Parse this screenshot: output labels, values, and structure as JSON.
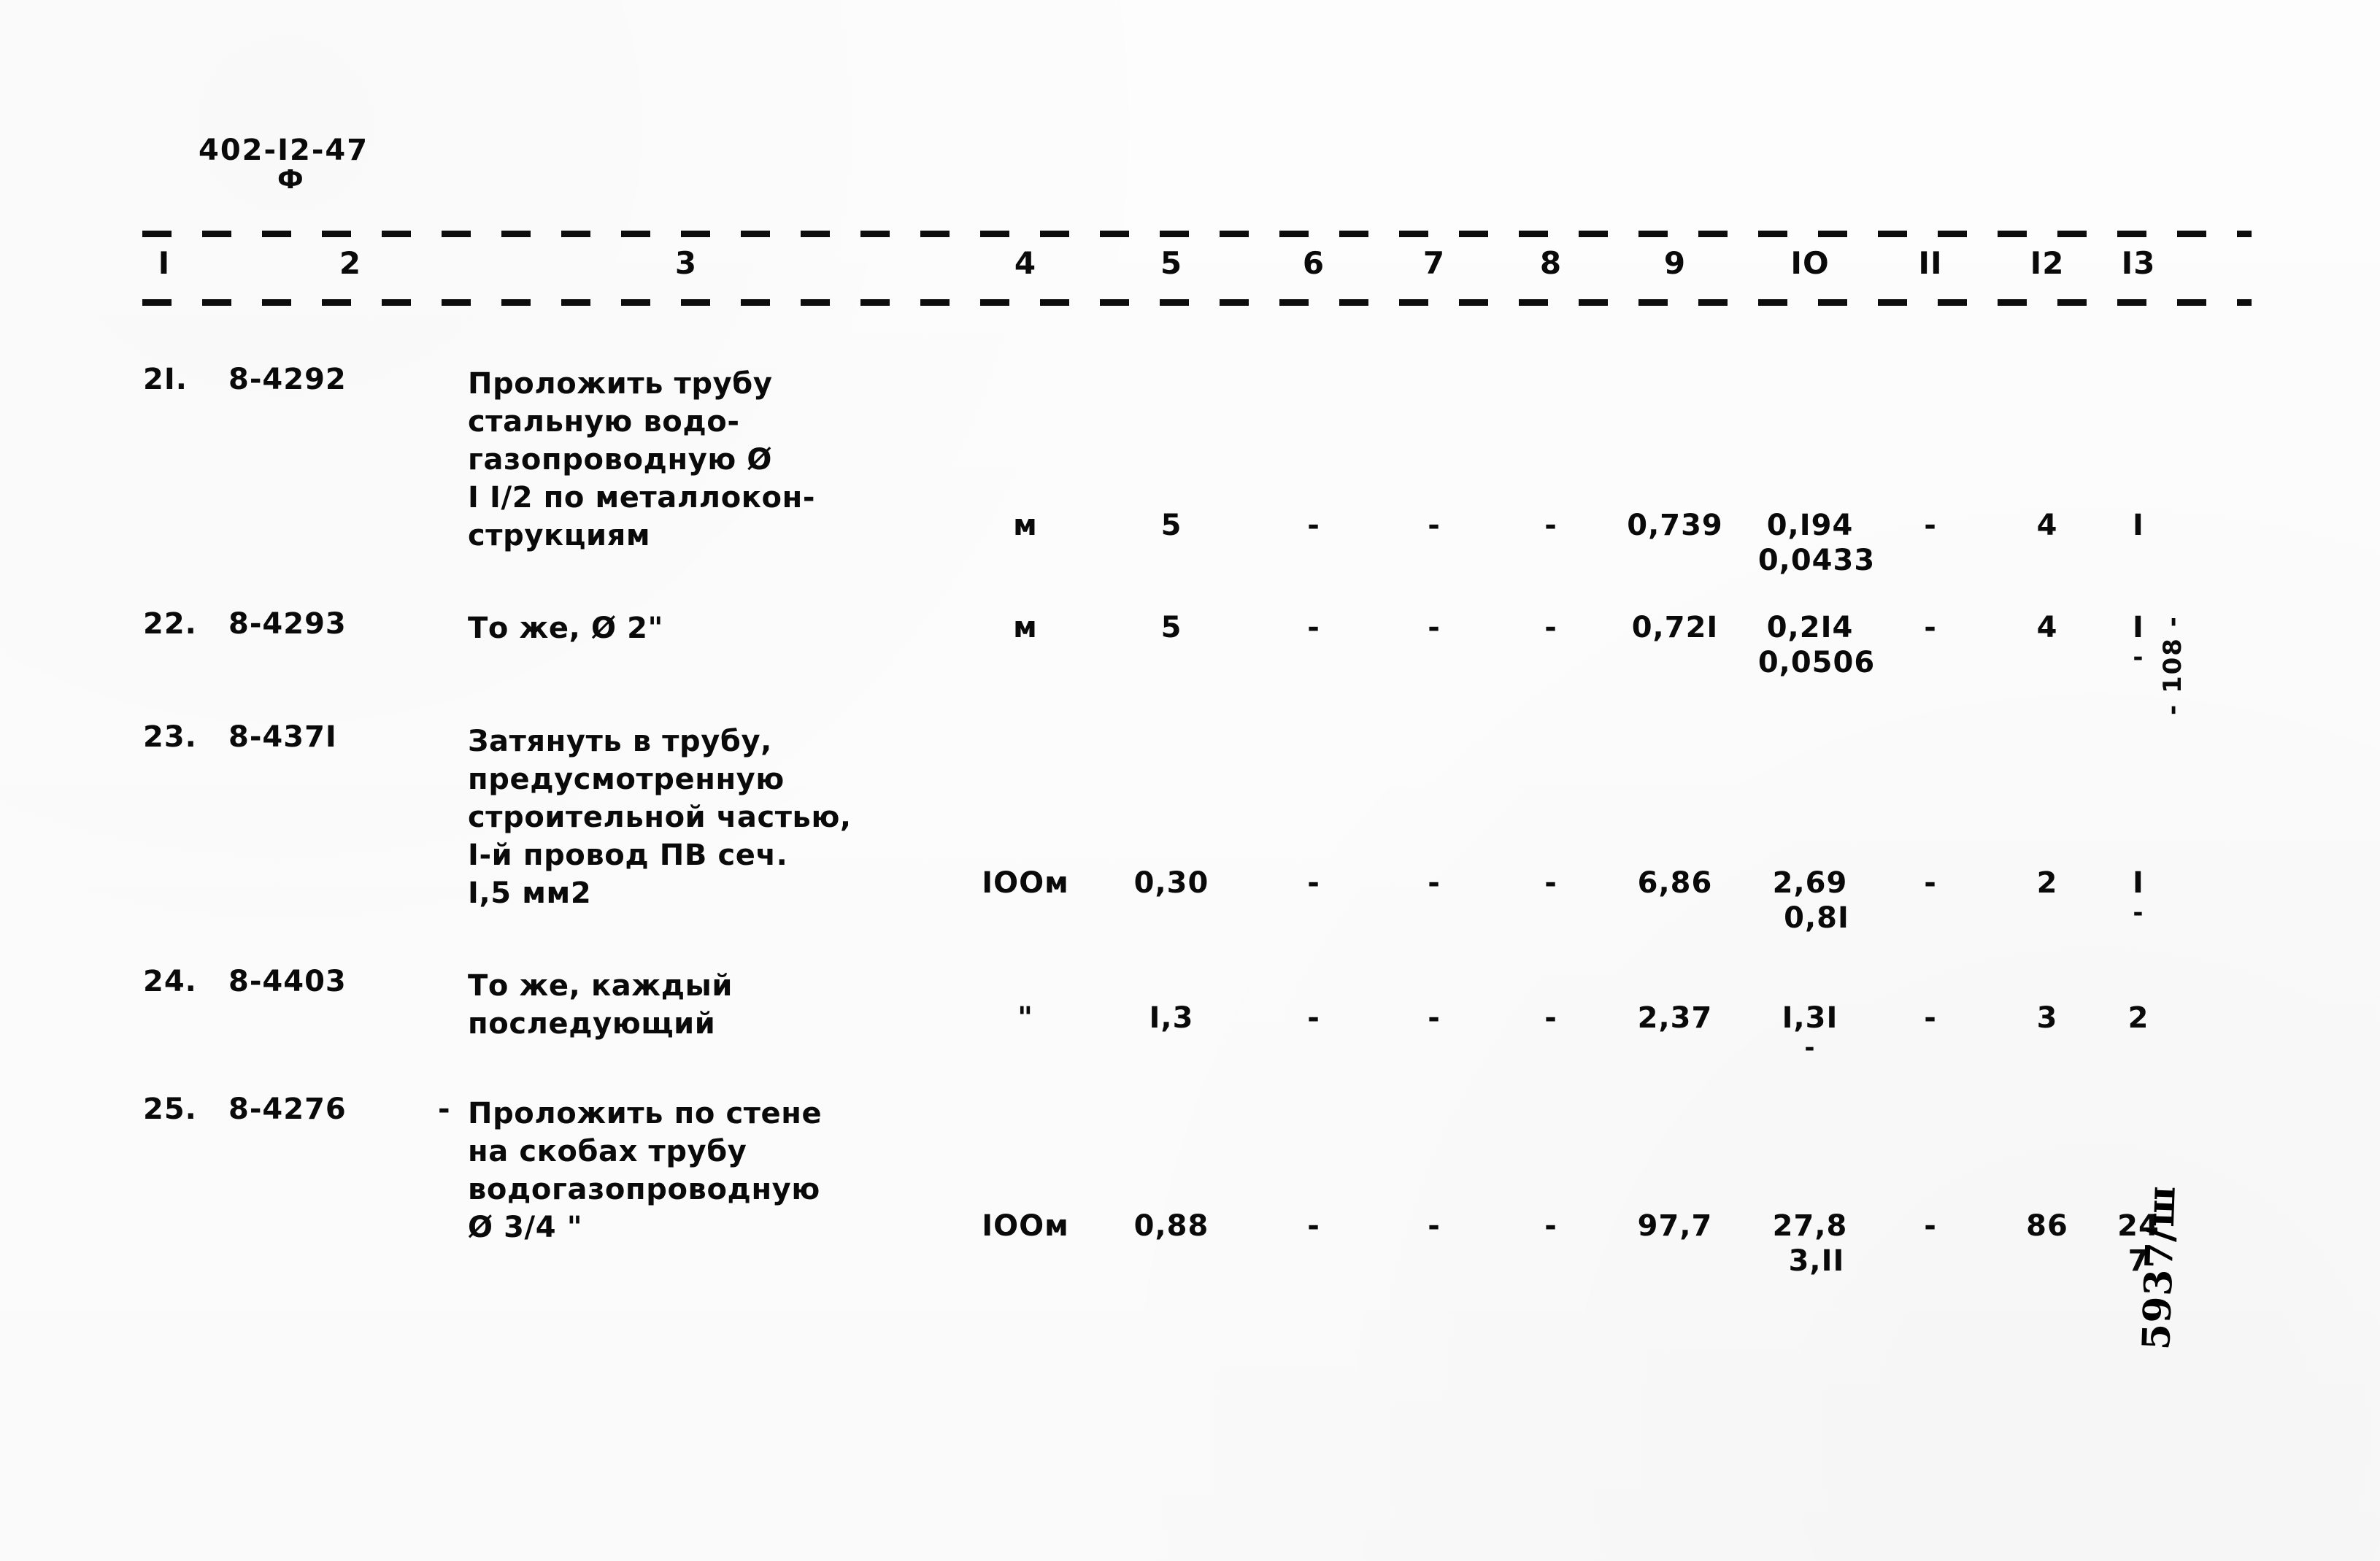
{
  "document": {
    "code": "402-I2-47",
    "code_mark": "Ф",
    "page_marker": "- 108 -",
    "corner_stamp": "5937/ш"
  },
  "table": {
    "column_headers": [
      "I",
      "2",
      "3",
      "4",
      "5",
      "6",
      "7",
      "8",
      "9",
      "IO",
      "II",
      "I2",
      "I3"
    ],
    "dash": "-",
    "rows": [
      {
        "no": "2I.",
        "code": "8-4292",
        "description": [
          "Проложить трубу",
          "стальную водо-",
          "газопроводную Ø",
          "I I/2 по металлокон-",
          "струкциям"
        ],
        "unit": "м",
        "qty": "5",
        "c6": "-",
        "c7": "-",
        "c8": "-",
        "c9": "0,739",
        "c10_main": "0,I94",
        "c10_sub": "0,0433",
        "c11": "-",
        "c12": "4",
        "c13": "I",
        "c13_dash": ""
      },
      {
        "no": "22.",
        "code": "8-4293",
        "description": [
          "То же, Ø 2\""
        ],
        "unit": "м",
        "qty": "5",
        "c6": "-",
        "c7": "-",
        "c8": "-",
        "c9": "0,72I",
        "c10_main": "0,2I4",
        "c10_sub": "0,0506",
        "c11": "-",
        "c12": "4",
        "c13": "I",
        "c13_dash": "-"
      },
      {
        "no": "23.",
        "code": "8-437I",
        "description": [
          "Затянуть в трубу,",
          "предусмотренную",
          "строительной частью,",
          "I-й провод ПВ сеч.",
          "I,5 мм2"
        ],
        "unit": "IOOм",
        "qty": "0,30",
        "c6": "-",
        "c7": "-",
        "c8": "-",
        "c9": "6,86",
        "c10_main": "2,69",
        "c10_sub": "0,8I",
        "c11": "-",
        "c12": "2",
        "c13": "I",
        "c13_dash": "-"
      },
      {
        "no": "24.",
        "code": "8-4403",
        "description": [
          "То же, каждый",
          "последующий"
        ],
        "unit": "\"",
        "qty": "I,3",
        "c6": "-",
        "c7": "-",
        "c8": "-",
        "c9": "2,37",
        "c10_main": "I,3I",
        "c10_sub": "",
        "c10_dash": "-",
        "c11": "-",
        "c12": "3",
        "c13": "2",
        "c13_dash": ""
      },
      {
        "no": "25.",
        "code": "8-4276",
        "lead_dash": "-",
        "description": [
          "Проложить по стене",
          "на скобах трубу",
          "водогазопроводную",
          "Ø 3/4 \""
        ],
        "unit": "IOOм",
        "qty": "0,88",
        "c6": "-",
        "c7": "-",
        "c8": "-",
        "c9": "97,7",
        "c10_main": "27,8",
        "c10_sub": "3,II",
        "c11": "-",
        "c12": "86",
        "c13": "24",
        "c13_sub": "7",
        "c13_dash": ""
      }
    ]
  },
  "colors": {
    "ink": "#0a0a0a",
    "paper": "#fdfdfd"
  }
}
